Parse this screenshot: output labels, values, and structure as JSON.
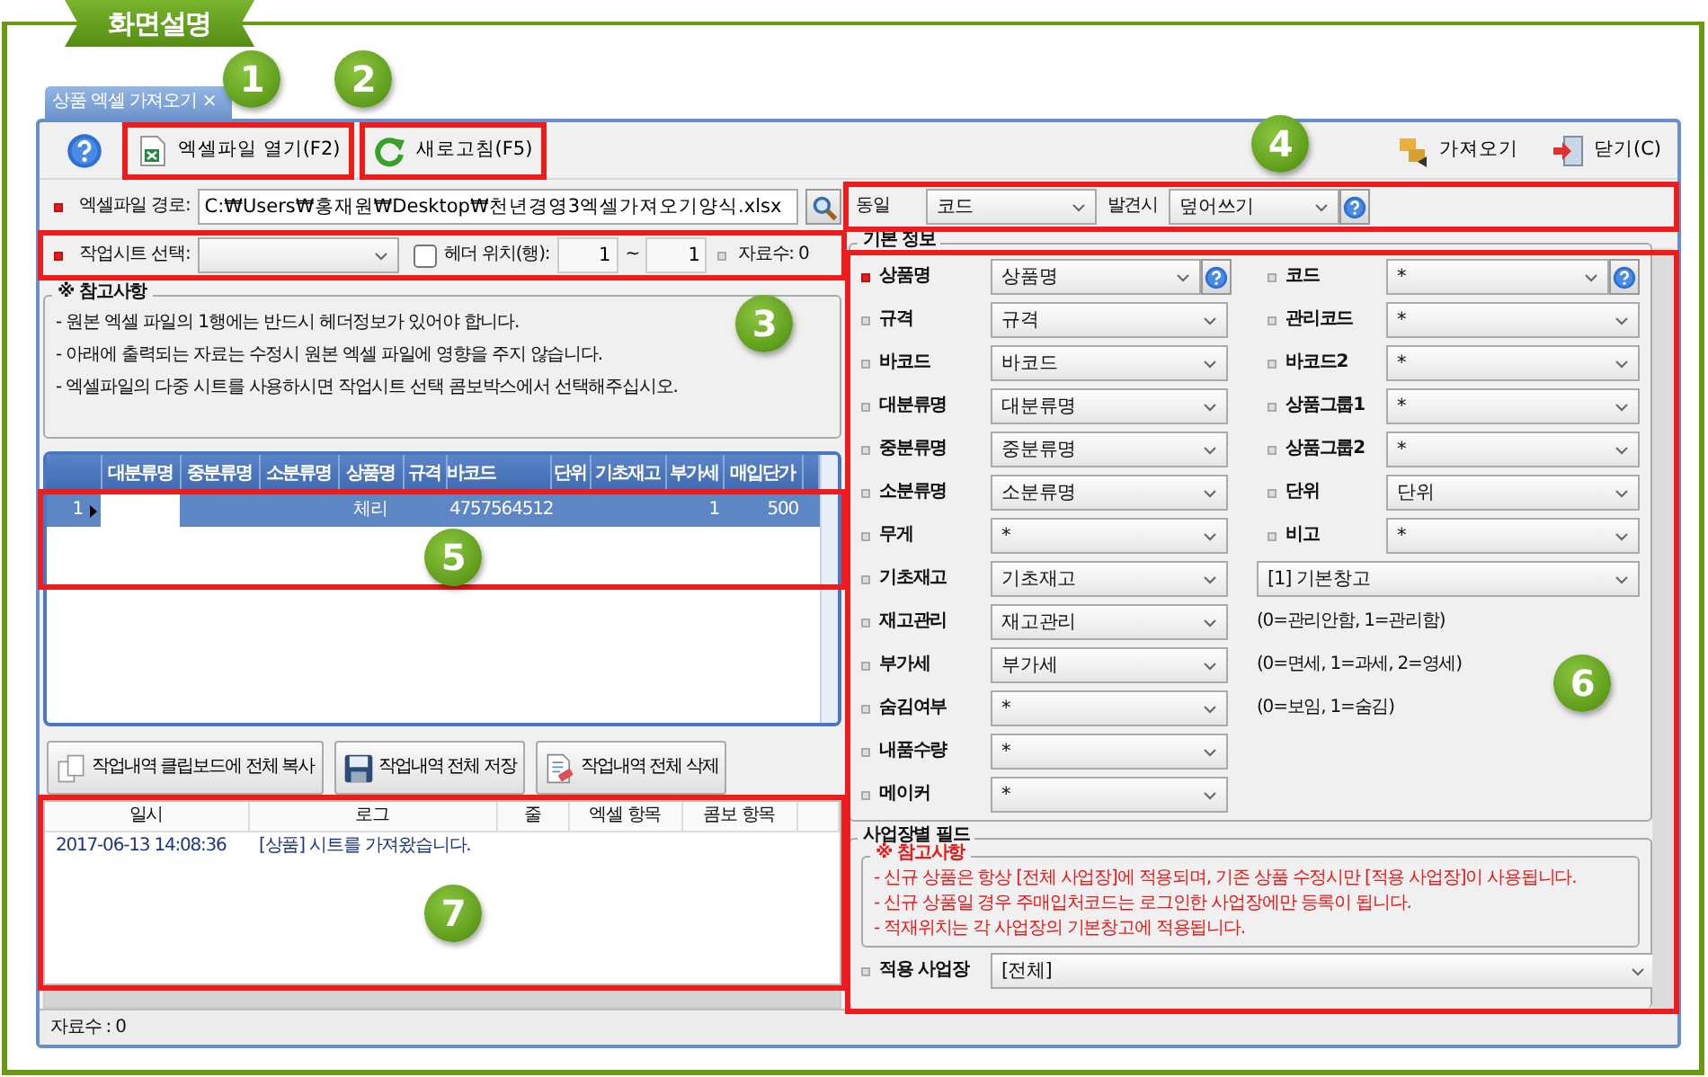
{
  "banner": {
    "title": "화면설명"
  },
  "tab": {
    "title": "상품 엑셀 가져오기",
    "close": "×"
  },
  "toolbar_left": [
    {
      "kind": "help"
    },
    {
      "kind": "excel",
      "label": "엑셀파일 열기(F2)"
    },
    {
      "kind": "refresh",
      "label": "새로고침(F5)"
    }
  ],
  "toolbar_right": [
    {
      "kind": "import",
      "label": "가져오기"
    },
    {
      "kind": "close",
      "label": "닫기(C)"
    }
  ],
  "file_path": {
    "label": "엑셀파일 경로:",
    "required": true,
    "value": "C:₩Users₩홍재원₩Desktop₩천년경영3엑셀가져오기양식.xlsx"
  },
  "sheet": {
    "label": "작업시트 선택:",
    "required": true
  },
  "header_row": {
    "label": "헤더 위치(행):",
    "checked": false,
    "from": "1",
    "separator": "~",
    "to": "1"
  },
  "count": {
    "label": "자료수: 0"
  },
  "notes": {
    "title": "※ 참고사항",
    "lines": [
      "- 원본 엑셀 파일의 1행에는 반드시 헤더정보가 있어야 합니다.",
      "- 아래에 출력되는 자료는 수정시 원본 엑셀 파일에 영향을 주지 않습니다.",
      "- 엑셀파일의 다중 시트를 사용하시면 작업시트 선택 콤보박스에서 선택해주십시오."
    ]
  },
  "grid": {
    "columns": [
      "대분류명",
      "중분류명",
      "소분류명",
      "상품명",
      "규격",
      "바코드",
      "단위",
      "기초재고",
      "부가세",
      "매입단가"
    ],
    "rows": [
      {
        "row_header": "1",
        "selected": true,
        "cells": [
          "",
          "",
          "",
          "체리",
          "",
          "4757564512",
          "",
          "",
          "1",
          "500"
        ]
      }
    ]
  },
  "buttons": [
    {
      "kind": "copy",
      "label": "작업내역 클립보드에 전체 복사"
    },
    {
      "kind": "save",
      "label": "작업내역 전체 저장"
    },
    {
      "kind": "delete",
      "label": "작업내역 전체 삭제"
    }
  ],
  "log": {
    "columns": [
      "일시",
      "로그",
      "줄",
      "엑셀 항목",
      "콤보 항목"
    ],
    "rows": [
      {
        "cells": [
          "2017-06-13 14:08:36",
          "[상품] 시트를 가져왔습니다.",
          "",
          "",
          ""
        ]
      }
    ]
  },
  "status_bar": {
    "text": "자료수 : 0"
  },
  "match": {
    "label": "동일",
    "key": "코드",
    "found_label": "발견시",
    "action": "덮어쓰기"
  },
  "basic_info": {
    "title": "기본 정보",
    "rows": [
      {
        "left": {
          "label": "상품명",
          "required": true,
          "value": "상품명",
          "help": true
        },
        "right": {
          "kind": "field",
          "label": "코드",
          "required": false,
          "value": "*",
          "help": true
        }
      },
      {
        "left": {
          "label": "규격",
          "required": false,
          "value": "규격",
          "help": false
        },
        "right": {
          "kind": "field",
          "label": "관리코드",
          "required": false,
          "value": "*",
          "help": false
        }
      },
      {
        "left": {
          "label": "바코드",
          "required": false,
          "value": "바코드",
          "help": false
        },
        "right": {
          "kind": "field",
          "label": "바코드2",
          "required": false,
          "value": "*",
          "help": false
        }
      },
      {
        "left": {
          "label": "대분류명",
          "required": false,
          "value": "대분류명",
          "help": false
        },
        "right": {
          "kind": "field",
          "label": "상품그룹1",
          "required": false,
          "value": "*",
          "help": false
        }
      },
      {
        "left": {
          "label": "중분류명",
          "required": false,
          "value": "중분류명",
          "help": false
        },
        "right": {
          "kind": "field",
          "label": "상품그룹2",
          "required": false,
          "value": "*",
          "help": false
        }
      },
      {
        "left": {
          "label": "소분류명",
          "required": false,
          "value": "소분류명",
          "help": false
        },
        "right": {
          "kind": "field",
          "label": "단위",
          "required": false,
          "value": "단위",
          "help": false
        }
      },
      {
        "left": {
          "label": "무게",
          "required": false,
          "value": "*",
          "help": false
        },
        "right": {
          "kind": "field",
          "label": "비고",
          "required": false,
          "value": "*",
          "help": false
        }
      },
      {
        "left": {
          "label": "기초재고",
          "required": false,
          "value": "기초재고",
          "help": false
        },
        "right": {
          "kind": "select",
          "value": "[1] 기본창고"
        }
      },
      {
        "left": {
          "label": "재고관리",
          "required": false,
          "value": "재고관리",
          "help": false
        },
        "right": {
          "kind": "note",
          "text": "(0=관리안함, 1=관리함)"
        }
      },
      {
        "left": {
          "label": "부가세",
          "required": false,
          "value": "부가세",
          "help": false
        },
        "right": {
          "kind": "note",
          "text": "(0=면세, 1=과세, 2=영세)"
        }
      },
      {
        "left": {
          "label": "숨김여부",
          "required": false,
          "value": "*",
          "help": false
        },
        "right": {
          "kind": "note",
          "text": "(0=보임, 1=숨김)"
        }
      },
      {
        "left": {
          "label": "내품수량",
          "required": false,
          "value": "*",
          "help": false
        }
      },
      {
        "left": {
          "label": "메이커",
          "required": false,
          "value": "*",
          "help": false
        }
      }
    ]
  },
  "branch_fields": {
    "title": "사업장별 필드",
    "notes": {
      "title": "※ 참고사항",
      "lines": [
        "- 신규 상품은 항상 [전체 사업장]에 적용되며, 기존 상품 수정시만 [적용 사업장]이 사용됩니다.",
        "- 신규 상품일 경우 주매입처코드는 로그인한 사업장에만 등록이 됩니다.",
        "- 적재위치는 각 사업장의 기본창고에 적용됩니다."
      ]
    },
    "fields": [
      {
        "label": "적용 사업장",
        "required": false,
        "value": "[전체]"
      }
    ]
  },
  "callouts": [
    {
      "number": "1"
    },
    {
      "number": "2"
    },
    {
      "number": "3"
    },
    {
      "number": "4"
    },
    {
      "number": "5"
    },
    {
      "number": "6"
    },
    {
      "number": "7"
    }
  ]
}
